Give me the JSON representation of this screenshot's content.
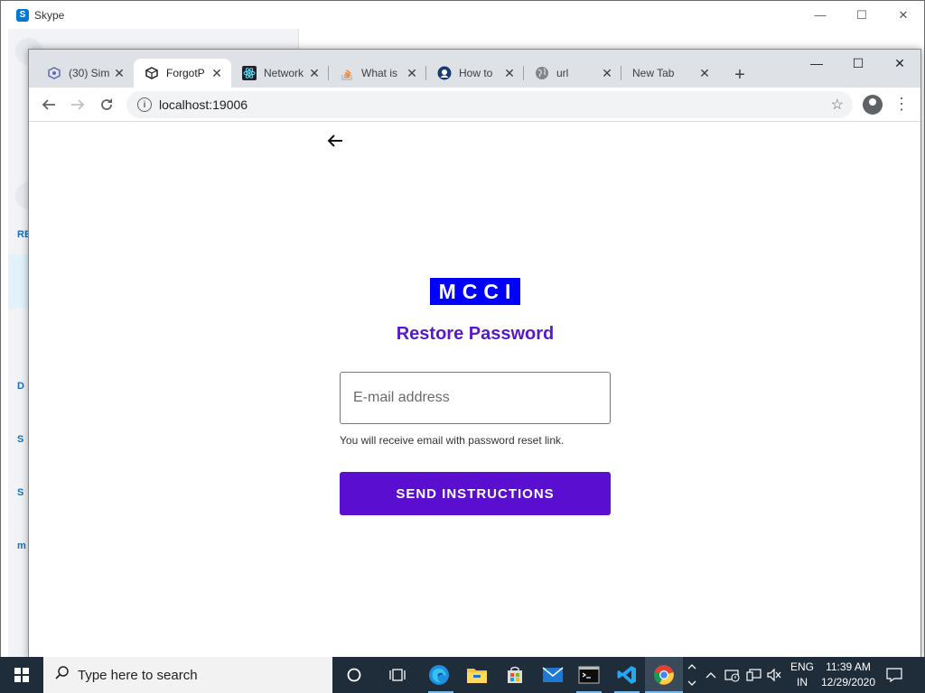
{
  "skype": {
    "title": "Skype",
    "minimize": "—",
    "maximize": "☐",
    "close": "✕",
    "sidebar_letters": [
      "RE",
      "D",
      "S",
      "S",
      "m"
    ]
  },
  "chrome": {
    "tabs": [
      {
        "label": "(30) Sim",
        "icon": "cube-icon"
      },
      {
        "label": "ForgotP",
        "icon": "expo-icon",
        "active": true
      },
      {
        "label": "Network",
        "icon": "react-icon"
      },
      {
        "label": "What is",
        "icon": "stackoverflow-icon"
      },
      {
        "label": "How to",
        "icon": "github-icon"
      },
      {
        "label": "url",
        "icon": "globe-icon"
      },
      {
        "label": "New Tab",
        "icon": ""
      }
    ],
    "new_tab": "+",
    "minimize": "—",
    "maximize": "☐",
    "close": "✕",
    "url": "localhost:19006"
  },
  "page": {
    "logo_text": "MCCI",
    "title": "Restore Password",
    "email_placeholder": "E-mail address",
    "email_value": "",
    "hint": "You will receive email with password reset link.",
    "send_button": "SEND INSTRUCTIONS",
    "colors": {
      "accent": "#5a0fd0",
      "logo_bg": "#0000ff",
      "heading": "#5a19c9"
    }
  },
  "taskbar": {
    "search_placeholder": "Type here to search",
    "language_line1": "ENG",
    "language_line2": "IN",
    "time": "11:39 AM",
    "date": "12/29/2020"
  }
}
